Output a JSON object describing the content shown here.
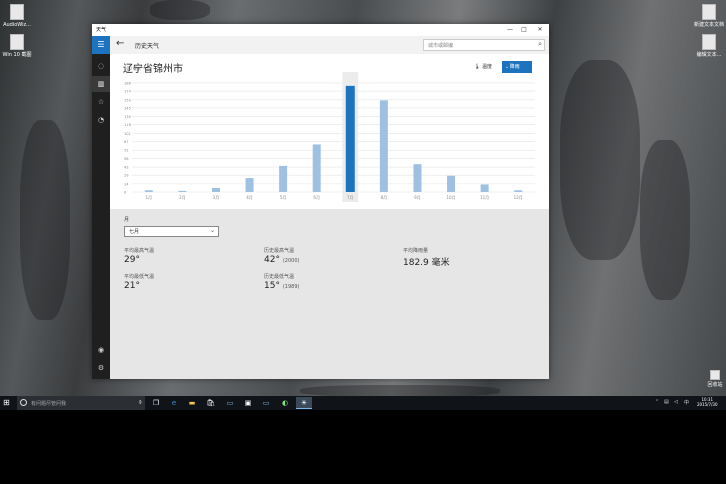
{
  "window": {
    "title": "天气",
    "controls": [
      "—",
      "□",
      "✕"
    ],
    "page_title": "历史天气",
    "search_placeholder": "城市或邮编",
    "city": "辽宁省锦州市",
    "toggle_temp": "温度",
    "toggle_rain": "降雨"
  },
  "nav": {
    "items": [
      "menu-icon",
      "home-icon",
      "map-icon",
      "favorites-icon",
      "history-icon"
    ],
    "bottom": [
      "account-icon",
      "settings-icon"
    ]
  },
  "chart_data": {
    "type": "bar",
    "ylabel": "100 毫米",
    "categories": [
      "1月",
      "2月",
      "3月",
      "4月",
      "5月",
      "6月",
      "7月",
      "8月",
      "9月",
      "10月",
      "11月",
      "12月"
    ],
    "values": [
      3,
      2,
      7,
      24,
      45,
      82,
      183,
      158,
      48,
      28,
      13,
      3
    ],
    "selected_index": 6,
    "ylim": [
      0,
      200
    ],
    "yticks": [
      0,
      14,
      29,
      43,
      58,
      72,
      87,
      101,
      116,
      130,
      145,
      159,
      174,
      188
    ],
    "bar_color": "#9ec1e2",
    "selected_color": "#1e73be"
  },
  "details": {
    "month_label": "月",
    "month_value": "七月",
    "avg_high_label": "平均最高气温",
    "avg_high_value": "29°",
    "avg_low_label": "平均最低气温",
    "avg_low_value": "21°",
    "rec_high_label": "历史最高气温",
    "rec_high_value": "42°",
    "rec_high_year": "(2000)",
    "rec_low_label": "历史最低气温",
    "rec_low_value": "15°",
    "rec_low_year": "(1989)",
    "avg_rain_label": "平均降雨量",
    "avg_rain_value": "182.9 毫米"
  },
  "desktop": {
    "icons_left": [
      "AudioWiz...",
      "Win 10 截图"
    ],
    "icons_right": [
      "新建文本文档",
      "编辑文本..."
    ],
    "recycle_bin": "回收站"
  },
  "taskbar": {
    "search_placeholder": "有问题尽管问我",
    "clock_time": "10:31",
    "clock_date": "2015/7/30"
  }
}
